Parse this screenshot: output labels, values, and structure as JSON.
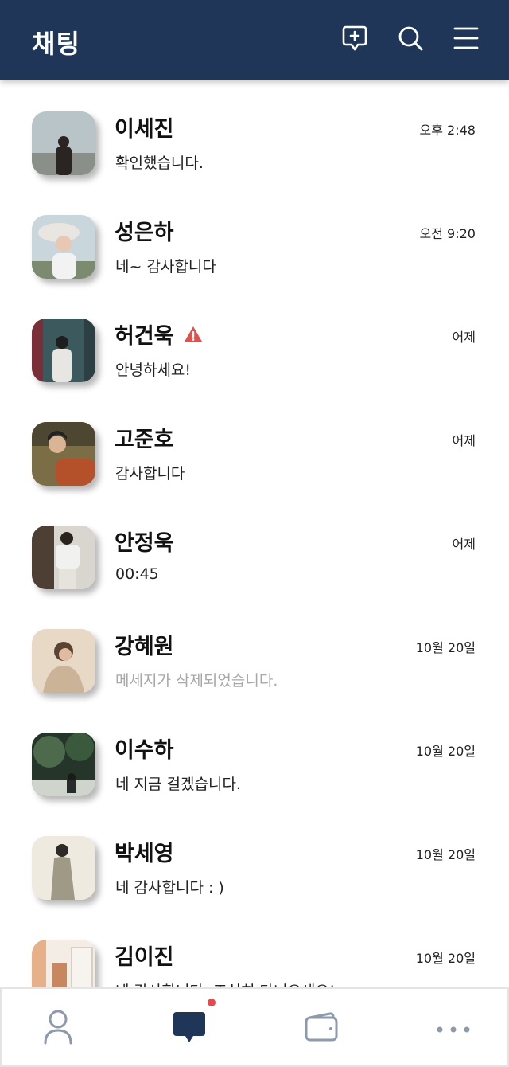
{
  "header": {
    "title": "채팅",
    "icons": [
      "new-chat-icon",
      "search-icon",
      "menu-icon"
    ],
    "background": "#1f3658"
  },
  "chats": [
    {
      "name": "이세진",
      "time": "오후 2:48",
      "preview": "확인했습니다.",
      "warning": false,
      "deleted": false,
      "avatar_colors": [
        "#b9c4c9",
        "#8a8f89",
        "#2a2422"
      ]
    },
    {
      "name": "성은하",
      "time": "오전 9:20",
      "preview": "네~ 감사합니다",
      "warning": false,
      "deleted": false,
      "avatar_colors": [
        "#c9d6dc",
        "#e9e6e2",
        "#7c8a70"
      ]
    },
    {
      "name": "허건욱",
      "time": "어제",
      "preview": "안녕하세요!",
      "warning": true,
      "deleted": false,
      "avatar_colors": [
        "#3c5a5e",
        "#e8e6e2",
        "#7a2f38"
      ]
    },
    {
      "name": "고준호",
      "time": "어제",
      "preview": "감사합니다",
      "warning": false,
      "deleted": false,
      "avatar_colors": [
        "#7b6d45",
        "#b5512a",
        "#4d4630"
      ]
    },
    {
      "name": "안정욱",
      "time": "어제",
      "preview": "00:45",
      "warning": false,
      "deleted": false,
      "avatar_colors": [
        "#4d3f33",
        "#f1f1f0",
        "#d9d5cf"
      ]
    },
    {
      "name": "강혜원",
      "time": "10월 20일",
      "preview": "메세지가 삭제되었습니다.",
      "warning": false,
      "deleted": true,
      "avatar_colors": [
        "#e8d8c6",
        "#cbb397",
        "#5a4333"
      ]
    },
    {
      "name": "이수하",
      "time": "10월 20일",
      "preview": "네 지금 걸겠습니다.",
      "warning": false,
      "deleted": false,
      "avatar_colors": [
        "#25352a",
        "#4d6a4c",
        "#cfd5cc"
      ]
    },
    {
      "name": "박세영",
      "time": "10월 20일",
      "preview": "네 감사합니다 : )",
      "warning": false,
      "deleted": false,
      "avatar_colors": [
        "#efeae0",
        "#9e9a86",
        "#2e2a26"
      ]
    },
    {
      "name": "김이진",
      "time": "10월 20일",
      "preview": "네 감사합니다. 조심히 다녀오세요!",
      "warning": false,
      "deleted": false,
      "avatar_colors": [
        "#e6b08a",
        "#f3ede6",
        "#c98760"
      ]
    }
  ],
  "bottom_nav": {
    "items": [
      "profile-icon",
      "chat-icon",
      "wallet-icon",
      "more-icon"
    ],
    "active": "chat-icon",
    "unread_dot_color": "#e5484d"
  },
  "colors": {
    "accent": "#1f3658",
    "warning": "#d9534f",
    "deleted_text": "#a8a8a8",
    "nav_icon": "#8c9aab"
  }
}
